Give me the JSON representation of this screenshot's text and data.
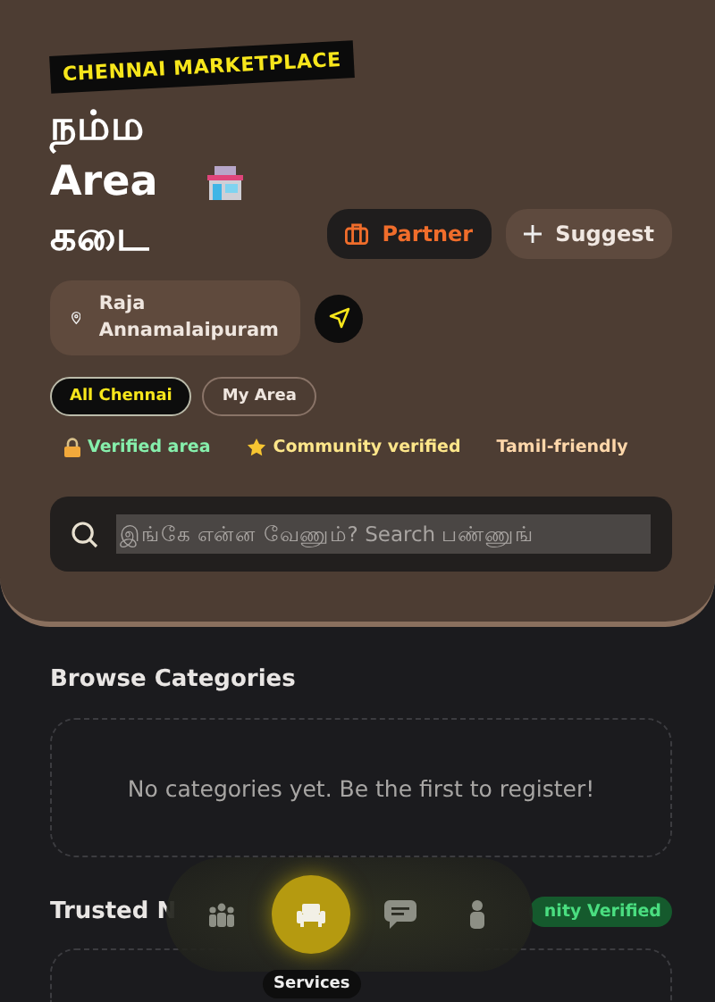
{
  "hero": {
    "badge": "CHENNAI MARKETPLACE",
    "title_lines": [
      "நம்ம",
      "Area",
      "கடை"
    ],
    "actions": [
      {
        "label": "Partner",
        "kind": "primary"
      },
      {
        "label": "Suggest",
        "kind": "secondary"
      }
    ],
    "location": "Raja Annamalaipuram",
    "scopes": [
      {
        "label": "All Chennai",
        "selected": true
      },
      {
        "label": "My Area",
        "selected": false
      }
    ],
    "tags": [
      {
        "label": "Verified area",
        "kind": "lock",
        "color": "#86efac"
      },
      {
        "label": "Community verified",
        "kind": "star",
        "color": "#fde68a"
      },
      {
        "label": "Tamil-friendly",
        "kind": "plain",
        "color": "#fed7aa"
      }
    ],
    "search": {
      "placeholder": "இங்கே என்ன வேணும்? Search பண்ணுங்"
    }
  },
  "browse": {
    "title": "Browse Categories",
    "empty": "No categories yet. Be the first to register!"
  },
  "trusted": {
    "title": "Trusted N",
    "badge": "nity Verified"
  },
  "nav": {
    "items": [
      {
        "kind": "people",
        "selected": false
      },
      {
        "kind": "shop",
        "selected": true
      },
      {
        "kind": "chat",
        "selected": false
      },
      {
        "kind": "person",
        "selected": false
      }
    ],
    "tooltip": "Services"
  }
}
